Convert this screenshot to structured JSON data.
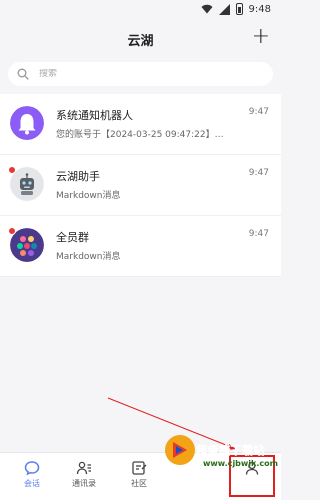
{
  "status_bar": {
    "time": "9:48"
  },
  "header": {
    "title": "云湖",
    "add_icon": "plus-icon"
  },
  "search": {
    "placeholder": "搜索",
    "icon": "search-icon"
  },
  "conversations": [
    {
      "name": "系统通知机器人",
      "message": "您的账号于【2024-03-25 09:47:22】…",
      "time": "9:47",
      "unread": false,
      "avatar": "bell-avatar"
    },
    {
      "name": "云湖助手",
      "message": "Markdown消息",
      "time": "9:47",
      "unread": true,
      "avatar": "robot-avatar"
    },
    {
      "name": "全员群",
      "message": "Markdown消息",
      "time": "9:47",
      "unread": true,
      "avatar": "group-avatar"
    }
  ],
  "tabs": [
    {
      "label": "会话",
      "active": true,
      "icon": "chat-icon"
    },
    {
      "label": "通讯录",
      "active": false,
      "icon": "contacts-icon"
    },
    {
      "label": "社区",
      "active": false,
      "icon": "community-icon"
    },
    {
      "label": "",
      "active": false,
      "icon": "hidden-tab-icon"
    },
    {
      "label": "",
      "active": false,
      "icon": "me-icon"
    }
  ],
  "watermark": {
    "title": "超级捷下载站",
    "url": "www.cjbwjk.com"
  },
  "colors": {
    "accent": "#5b7cf0",
    "unread": "#e53935",
    "annotation": "#e02020"
  }
}
